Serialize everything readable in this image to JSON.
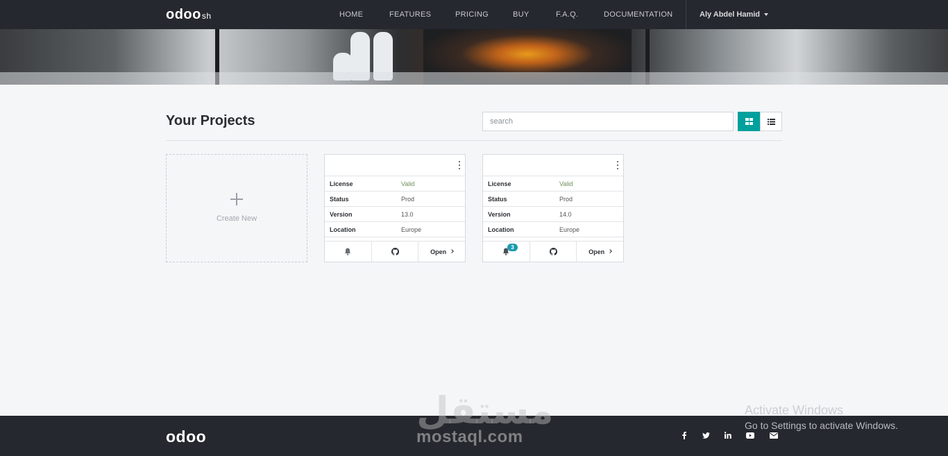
{
  "navbar": {
    "logo": "odoo",
    "logo_suffix": "sh",
    "links": [
      "HOME",
      "FEATURES",
      "PRICING",
      "BUY",
      "F.A.Q.",
      "DOCUMENTATION"
    ],
    "user_name": "Aly Abdel Hamid"
  },
  "projects": {
    "title": "Your Projects",
    "search_placeholder": "search",
    "create_label": "Create New",
    "cards": [
      {
        "rows": [
          {
            "key": "License",
            "value": "Valid"
          },
          {
            "key": "Status",
            "value": "Prod"
          },
          {
            "key": "Version",
            "value": "13.0"
          },
          {
            "key": "Location",
            "value": "Europe"
          }
        ],
        "notification_count": "",
        "open_label": "Open"
      },
      {
        "rows": [
          {
            "key": "License",
            "value": "Valid"
          },
          {
            "key": "Status",
            "value": "Prod"
          },
          {
            "key": "Version",
            "value": "14.0"
          },
          {
            "key": "Location",
            "value": "Europe"
          }
        ],
        "notification_count": "3",
        "open_label": "Open"
      }
    ]
  },
  "footer": {
    "logo": "odoo",
    "social_icons": [
      "facebook-icon",
      "twitter-icon",
      "linkedin-icon",
      "youtube-icon",
      "email-icon"
    ]
  },
  "watermark": {
    "arabic": "مستقل",
    "latin": "mostaql.com"
  },
  "windows_activation": {
    "title": "Activate Windows",
    "subtitle": "Go to Settings to activate Windows."
  },
  "colors": {
    "navbar_bg": "#25282e",
    "accent": "#00a09d",
    "badge": "#1b9bb1",
    "page_bg": "#f5f6f8"
  }
}
